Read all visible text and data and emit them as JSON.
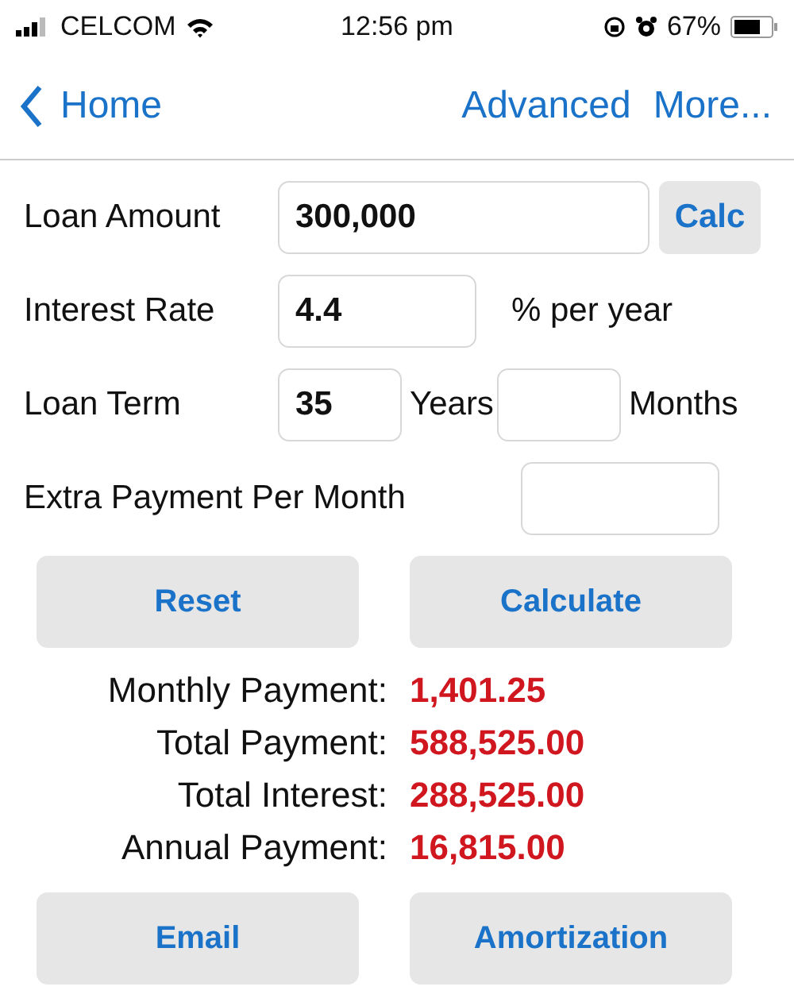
{
  "status_bar": {
    "carrier": "CELCOM",
    "time": "12:56 pm",
    "battery": "67%"
  },
  "nav": {
    "back": "Home",
    "actions": [
      "Advanced",
      "More..."
    ]
  },
  "loan_amount": {
    "label": "Loan Amount",
    "value": "300,000",
    "button": "Calc"
  },
  "interest_rate": {
    "label": "Interest Rate",
    "value": "4.4",
    "unit": "% per year"
  },
  "loan_term": {
    "label": "Loan Term",
    "years_value": "35",
    "years_unit": "Years",
    "months_unit": "Months"
  },
  "extra_payment": {
    "label": "Extra Payment Per Month"
  },
  "top_buttons": [
    "Reset",
    "Calculate"
  ],
  "results": [
    {
      "label": "Monthly Payment:",
      "value": "1,401.25"
    },
    {
      "label": "Total Payment:",
      "value": "588,525.00"
    },
    {
      "label": "Total Interest:",
      "value": "288,525.00"
    },
    {
      "label": "Annual Payment:",
      "value": "16,815.00"
    }
  ],
  "bottom_buttons": [
    "Email",
    "Amortization"
  ]
}
